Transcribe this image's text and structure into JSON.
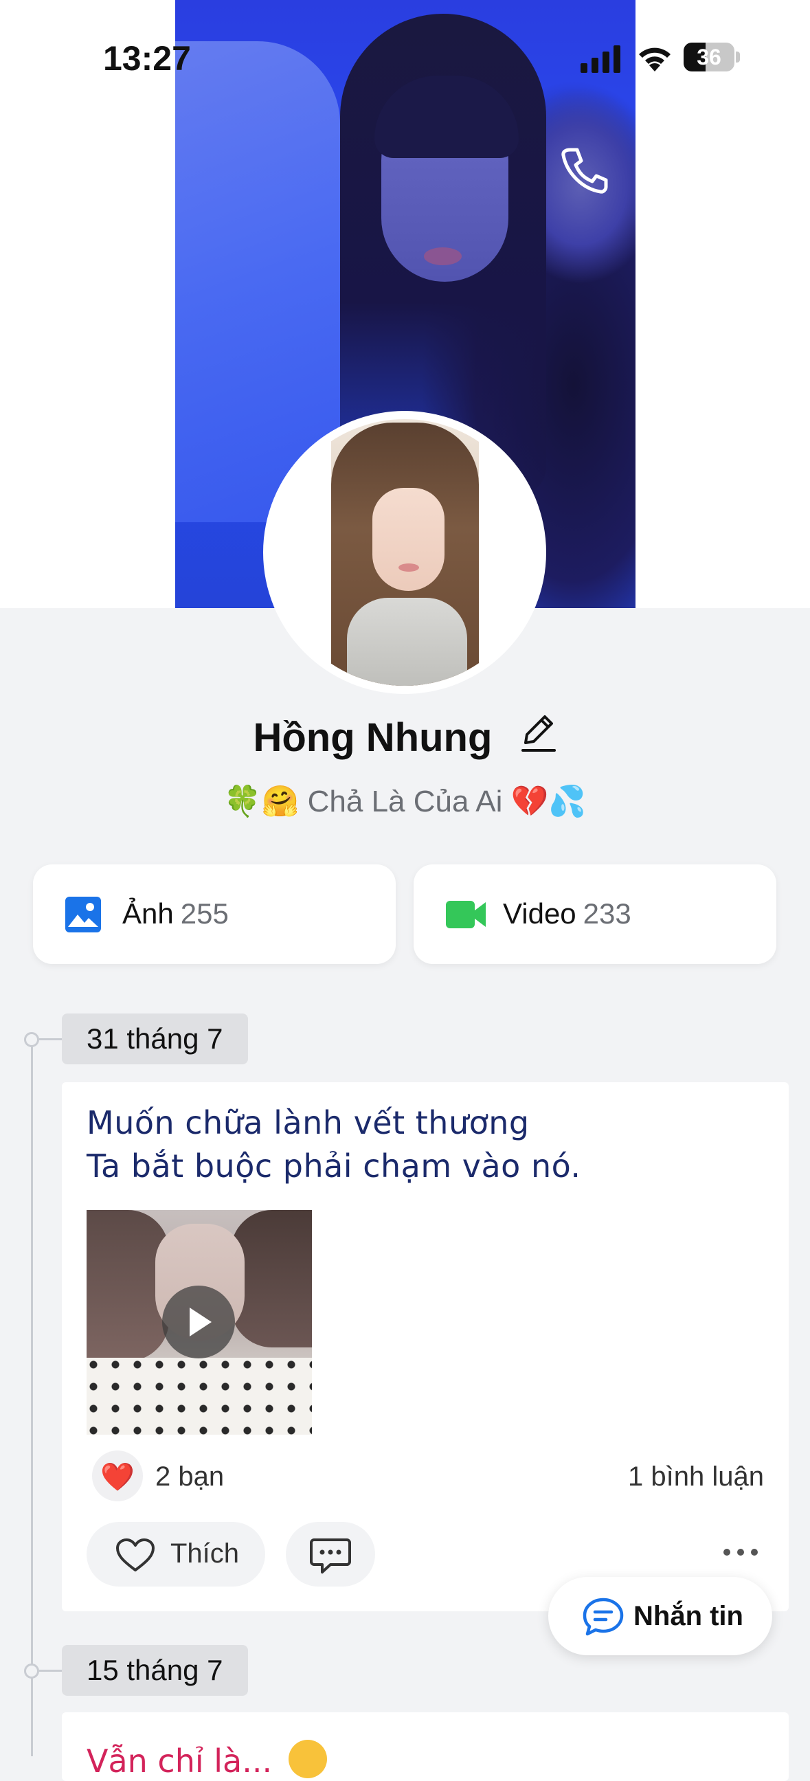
{
  "status_bar": {
    "time": "13:27",
    "battery": "36"
  },
  "nav": {
    "back_icon": "chevron-left-icon",
    "call_icon": "phone-icon",
    "settings_icon": "user-settings-icon",
    "more_icon": "more-horizontal-icon"
  },
  "profile": {
    "name": "Hồng Nhung",
    "bio": "🍀🤗 Chả Là Của Ai 💔💦"
  },
  "media": {
    "photos_label": "Ảnh",
    "photos_count": "255",
    "videos_label": "Video",
    "videos_count": "233"
  },
  "timeline": {
    "posts": [
      {
        "date": "31 tháng 7",
        "text_lines": [
          "Muốn chữa lành vết thương",
          "Ta bắt buộc phải chạm vào nó."
        ],
        "reaction_emoji": "❤️",
        "reaction_count": "2 bạn",
        "comment_count": "1 bình luận",
        "like_label": "Thích"
      },
      {
        "date": "15 tháng 7",
        "text_partial": "Vẫn chỉ là..."
      }
    ]
  },
  "message_button": {
    "label": "Nhắn tin"
  },
  "colors": {
    "accent_blue": "#1a73e8",
    "post_text": "#1b2a6b",
    "video_green": "#34c759",
    "post2_text": "#d3235a"
  }
}
